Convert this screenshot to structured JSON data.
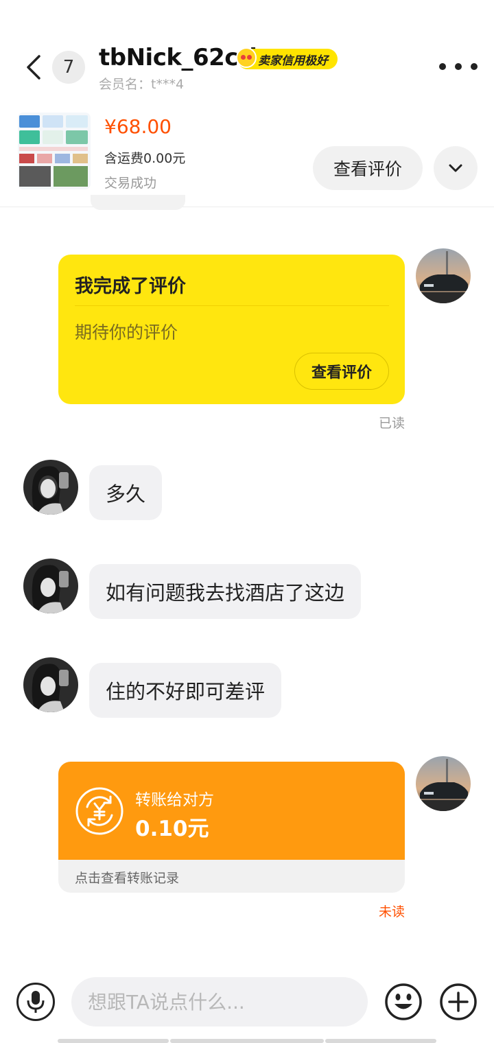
{
  "header": {
    "unread_count": "7",
    "nickname": "tbNick_62cri",
    "credit_badge": "卖家信用极好",
    "member_name": "会员名：t***4"
  },
  "product": {
    "price": "¥68.00",
    "shipping": "含运费0.00元",
    "status": "交易成功",
    "view_review_button": "查看评价"
  },
  "messages": {
    "review_card": {
      "title": "我完成了评价",
      "subtitle": "期待你的评价",
      "button": "查看评价",
      "read_status": "已读"
    },
    "incoming": [
      {
        "text": "多久"
      },
      {
        "text": "如有问题我去找酒店了这边"
      },
      {
        "text": "住的不好即可差评"
      }
    ],
    "transfer": {
      "label": "转账给对方",
      "amount": "0.10元",
      "record_link": "点击查看转账记录",
      "read_status": "未读"
    }
  },
  "input_bar": {
    "placeholder": "想跟TA说点什么..."
  },
  "colors": {
    "accent_orange": "#ff5000",
    "review_yellow": "#ffe60f",
    "transfer_orange": "#ff9a0f",
    "unread_red": "#ff5000",
    "read_gray": "#999999"
  },
  "icons": [
    "back-arrow-icon",
    "more-dots-icon",
    "chevron-down-icon",
    "yuan-transfer-icon",
    "microphone-icon",
    "emoji-icon",
    "plus-icon"
  ]
}
